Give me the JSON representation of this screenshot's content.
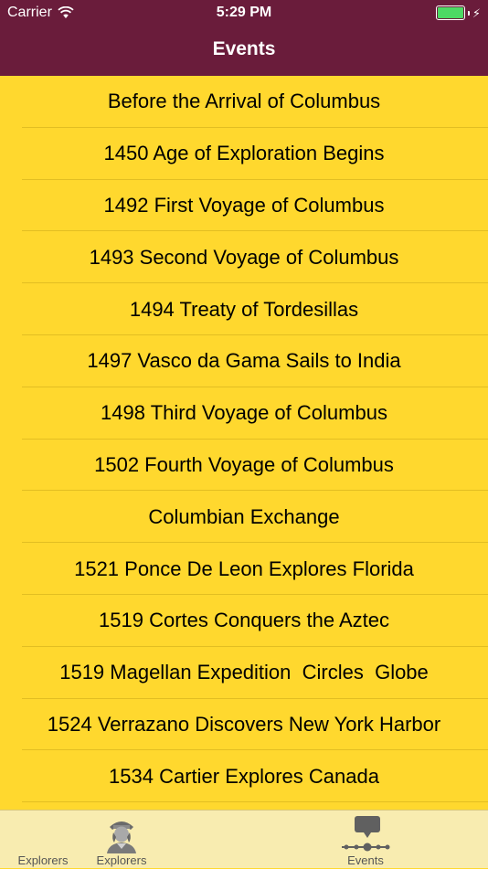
{
  "status_bar": {
    "carrier": "Carrier",
    "time": "5:29 PM"
  },
  "header": {
    "title": "Events"
  },
  "events": [
    "Before the Arrival of Columbus",
    "1450 Age of Exploration Begins",
    "1492 First Voyage of Columbus",
    "1493 Second Voyage of Columbus",
    "1494 Treaty of Tordesillas",
    "1497 Vasco da Gama Sails to India",
    "1498 Third Voyage of Columbus",
    "1502 Fourth Voyage of Columbus",
    "Columbian Exchange",
    "1521 Ponce De Leon Explores Florida",
    "1519 Cortes Conquers the Aztec",
    "1519 Magellan Expedition  Circles  Globe",
    "1524 Verrazano Discovers New York Harbor",
    "1534 Cartier Explores Canada"
  ],
  "tabs": [
    {
      "label": "Explorers",
      "icon": "none"
    },
    {
      "label": "Explorers",
      "icon": "explorer-portrait-icon"
    },
    {
      "label": "Events",
      "icon": "timeline-icon"
    }
  ],
  "colors": {
    "header": "#6A1C3B",
    "background": "#FFD82E",
    "tab_bar": "#F8ECB0",
    "battery": "#4CD964"
  }
}
